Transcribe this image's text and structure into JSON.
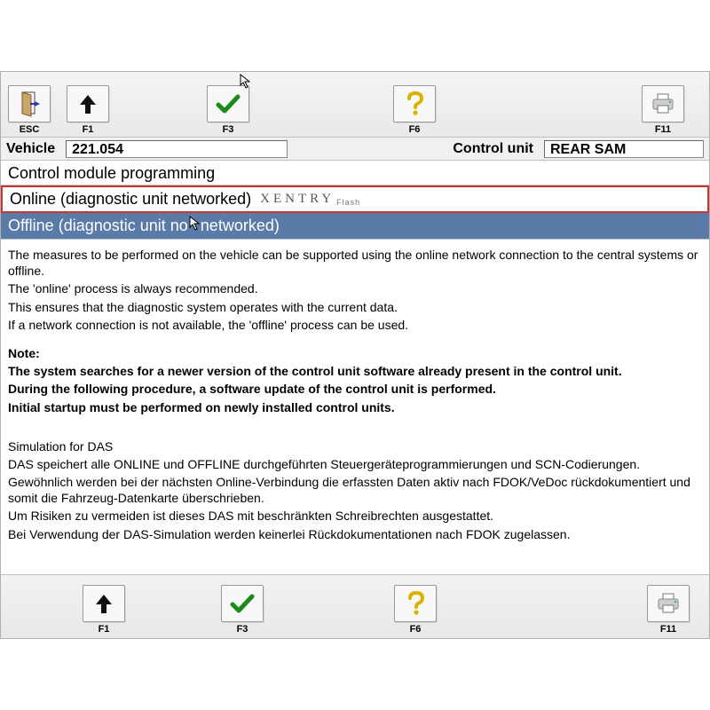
{
  "toolbar": {
    "esc": "ESC",
    "f1": "F1",
    "f3": "F3",
    "f6": "F6",
    "f11": "F11"
  },
  "info": {
    "vehicle_label": "Vehicle",
    "vehicle_value": "221.054",
    "cu_label": "Control unit",
    "cu_value": "REAR SAM"
  },
  "section_heading": "Control module programming",
  "option_online_text": "Online (diagnostic unit networked)",
  "option_online_brand": "XENTRY",
  "option_online_flash": "Flash",
  "option_offline_pre": "Offline (diagnostic unit no",
  "option_offline_post": "networked)",
  "body": {
    "p1": "The measures to be performed on the vehicle can be supported using the online network connection to the central systems or offline.",
    "p2": "The 'online' process is always recommended.",
    "p3": "This ensures that the diagnostic system operates with the current data.",
    "p4": "If a network connection is not available, the 'offline' process can be used.",
    "note_label": "Note:",
    "n1": "The system searches for a newer version of the control unit software already present in the control unit.",
    "n2": "During the following procedure, a software update of the control unit is performed.",
    "n3": "Initial startup must be performed on newly installed control units.",
    "sim_title": "Simulation for DAS",
    "s1": "DAS speichert alle ONLINE und OFFLINE durchgeführten Steuergeräteprogrammierungen und SCN-Codierungen.",
    "s2": "Gewöhnlich werden bei der nächsten Online-Verbindung die erfassten Daten aktiv nach FDOK/VeDoc rückdokumentiert und somit die Fahrzeug-Datenkarte überschrieben.",
    "s3": "Um Risiken zu vermeiden ist dieses DAS mit beschränkten Schreibrechten ausgestattet.",
    "s4": "Bei Verwendung der DAS-Simulation werden keinerlei Rückdokumentationen nach FDOK zugelassen."
  },
  "icons": {
    "exit": "exit-door-icon",
    "up": "arrow-up-icon",
    "check": "checkmark-icon",
    "help": "question-icon",
    "print": "printer-icon"
  }
}
